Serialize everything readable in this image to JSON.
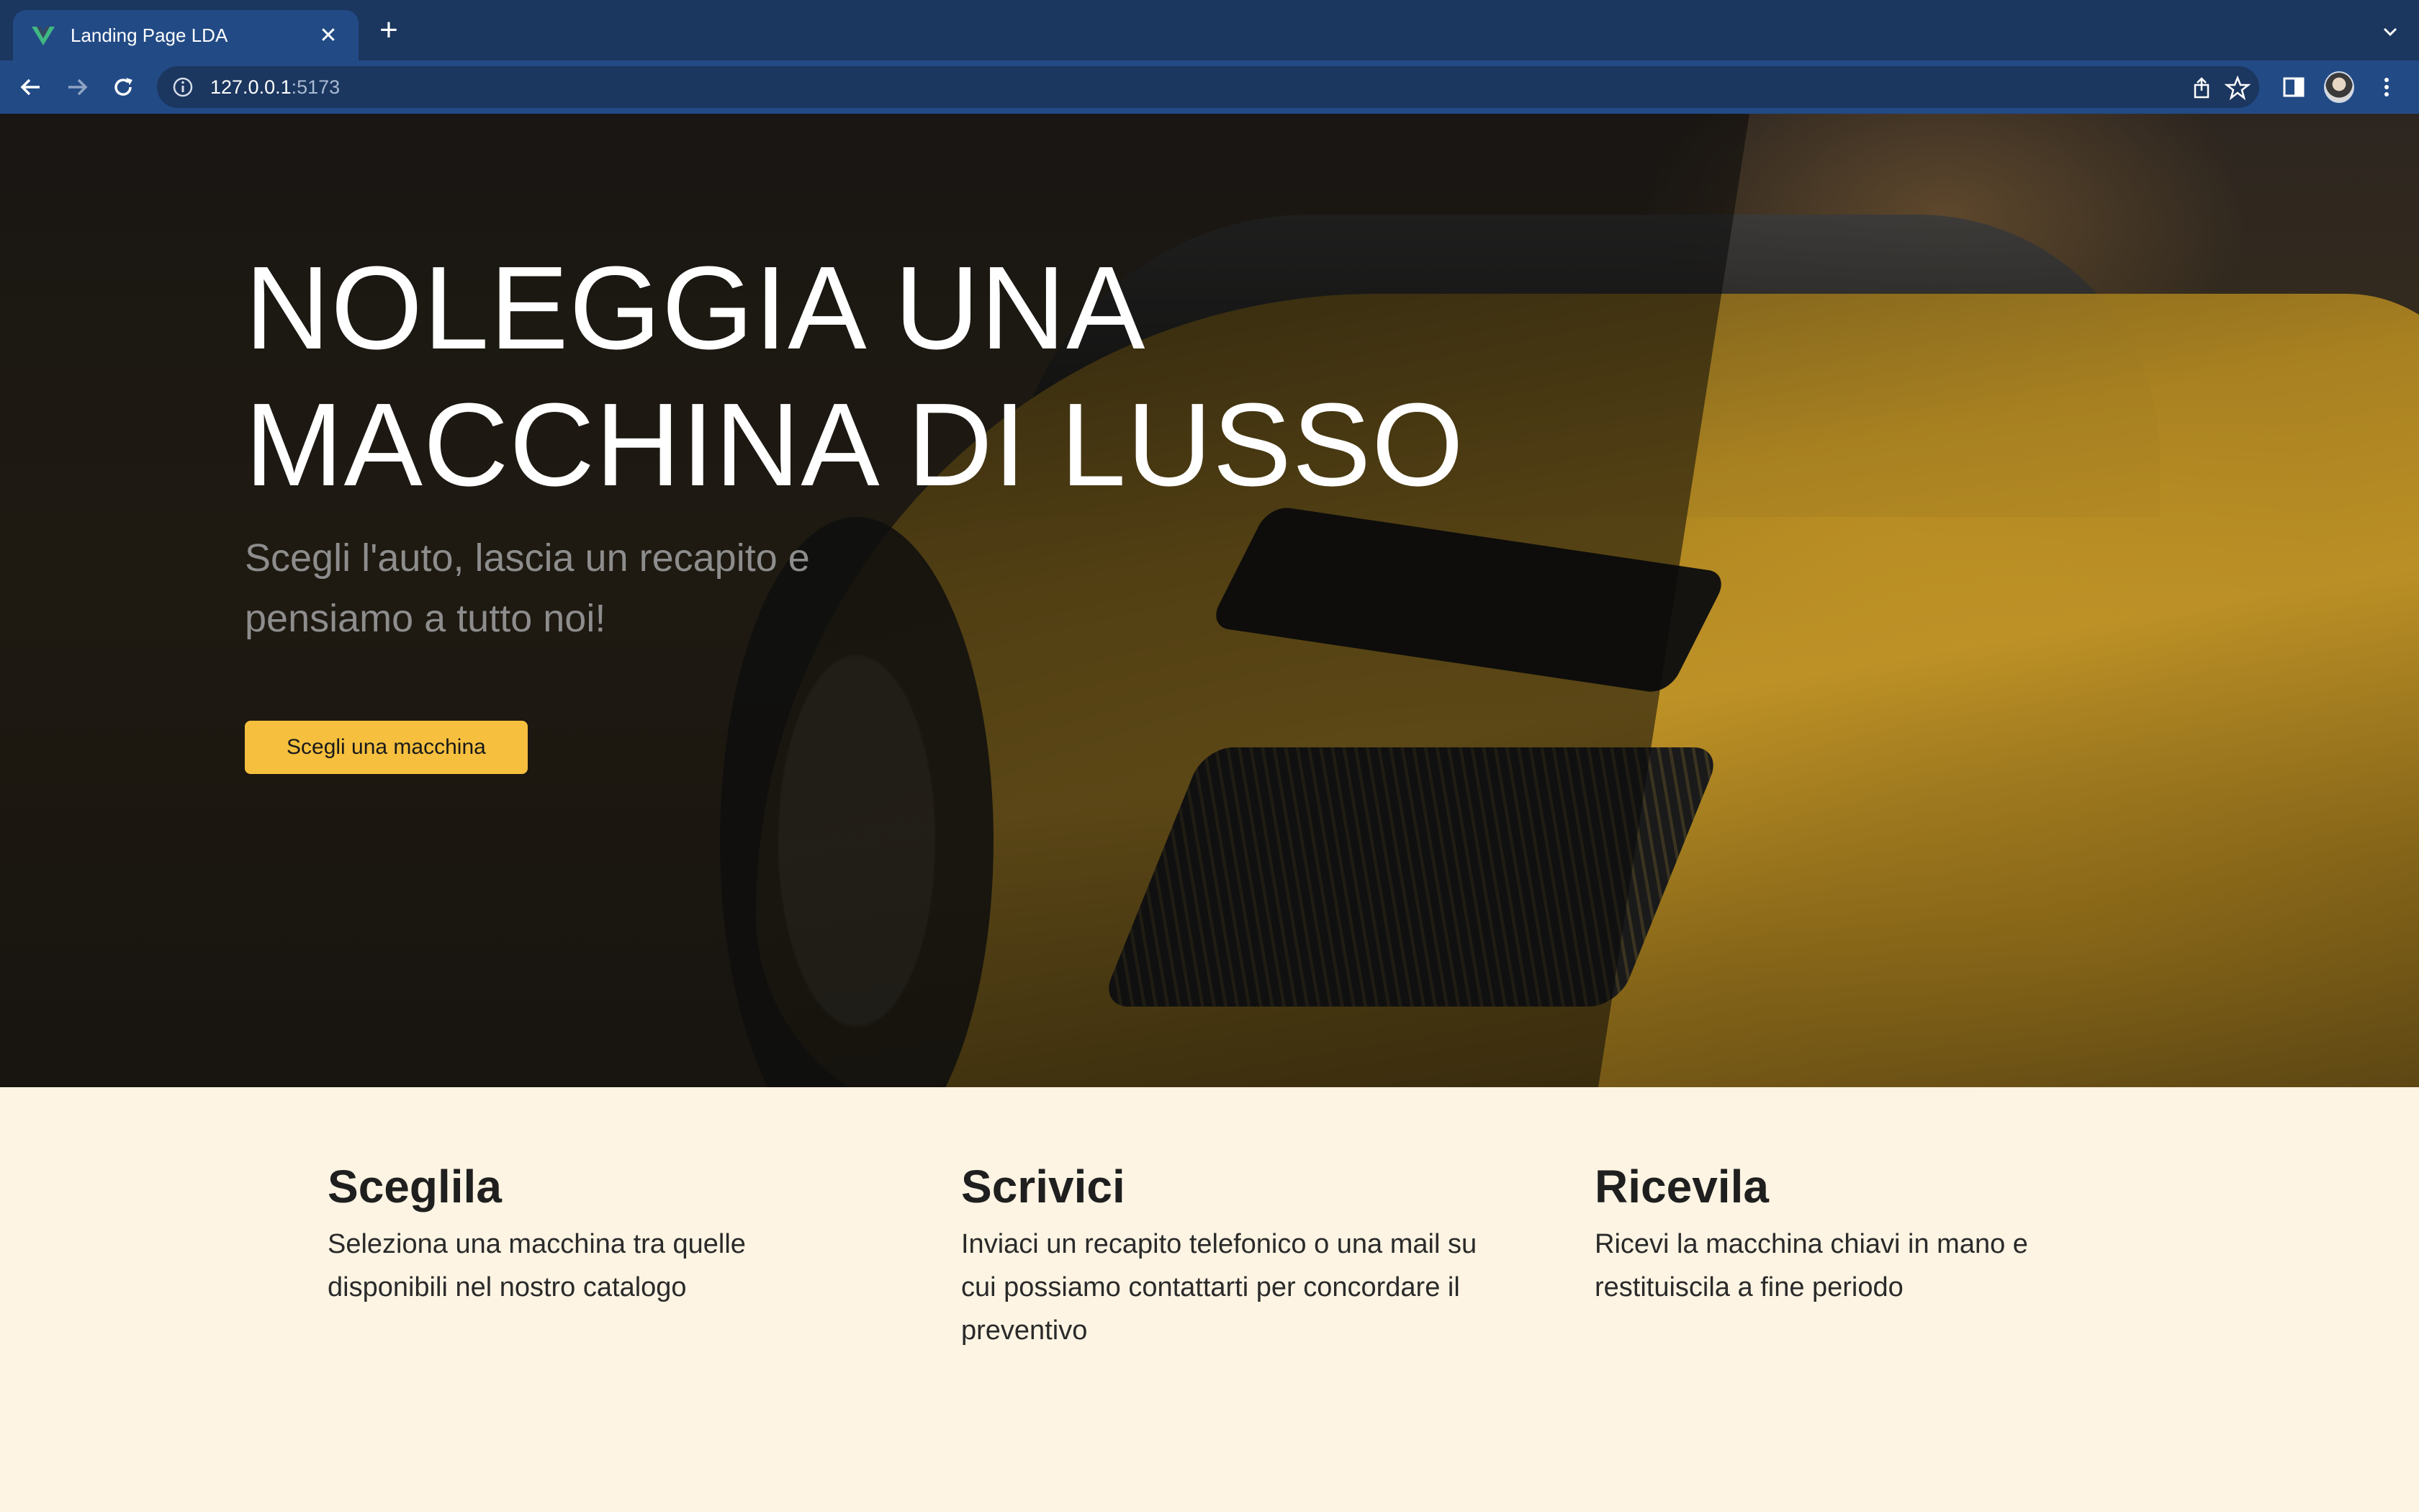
{
  "browser": {
    "tab_title": "Landing Page LDA",
    "url_host": "127.0.0.1",
    "url_port": ":5173"
  },
  "hero": {
    "title_line1": "NOLEGGIA UNA",
    "title_line2": "MACCHINA DI LUSSO",
    "subtitle": "Scegli l'auto, lascia un recapito e pensiamo a tutto noi!",
    "cta_label": "Scegli una macchina"
  },
  "features": [
    {
      "title": "Sceglila",
      "text": "Seleziona una macchina tra quelle disponibili nel nostro catalogo"
    },
    {
      "title": "Scrivici",
      "text": "Inviaci un recapito telefonico o una mail su cui possiamo contattarti per concordare il preventivo"
    },
    {
      "title": "Ricevila",
      "text": "Ricevi la macchina chiavi in mano e restituiscila a fine periodo"
    }
  ],
  "colors": {
    "accent": "#f6c03e",
    "tabbar": "#1b365f",
    "toolbar": "#224a85",
    "features_bg": "#fdf4e3"
  }
}
